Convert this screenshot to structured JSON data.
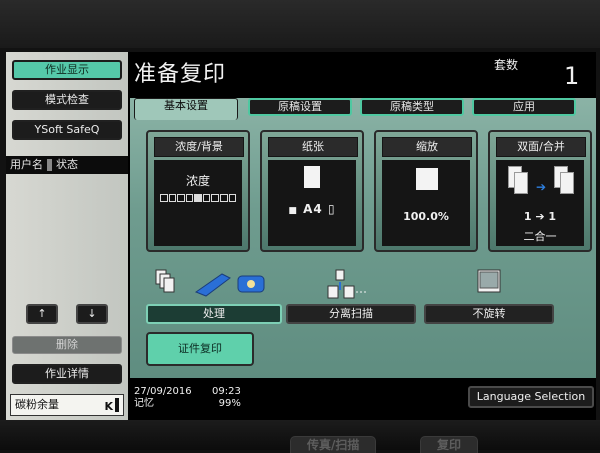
{
  "screen_title": "准备复印",
  "copies": {
    "label": "套数",
    "value": "1"
  },
  "left_panel": {
    "job_display": "作业显示",
    "mode_check": "模式检查",
    "ysoft": "YSoft SafeQ",
    "user_col": "用户名",
    "status_col": "状态",
    "up_label": "↑",
    "down_label": "↓",
    "delete": "删除",
    "job_detail": "作业详情",
    "toner_label": "碳粉余量",
    "toner_level": "K"
  },
  "tabs": [
    "基本设置",
    "原稿设置",
    "原稿类型",
    "应用"
  ],
  "cards": {
    "density": {
      "title": "浓度/背景",
      "label": "浓度",
      "steps": 9,
      "selected_step": 5
    },
    "paper": {
      "title": "纸张",
      "tray": "■",
      "size": "A4",
      "orientation": "▯"
    },
    "zoom": {
      "title": "缩放",
      "value": "100.0%"
    },
    "duplex": {
      "title": "双面/合并",
      "mode": "1 ➔ 1",
      "combine": "二合一"
    }
  },
  "functions": {
    "finishing": "处理",
    "separate_scan": "分离扫描",
    "no_rotate": "不旋转",
    "id_copy": "证件复印"
  },
  "status": {
    "date": "27/09/2016",
    "memory_label": "记忆",
    "time": "09:23",
    "memory_value": "99%"
  },
  "language_button": "Language Selection",
  "bezel_tabs": [
    "传真/扫描",
    "复印"
  ],
  "colors": {
    "accent": "#55c8a9",
    "panel": "#7fa797"
  }
}
